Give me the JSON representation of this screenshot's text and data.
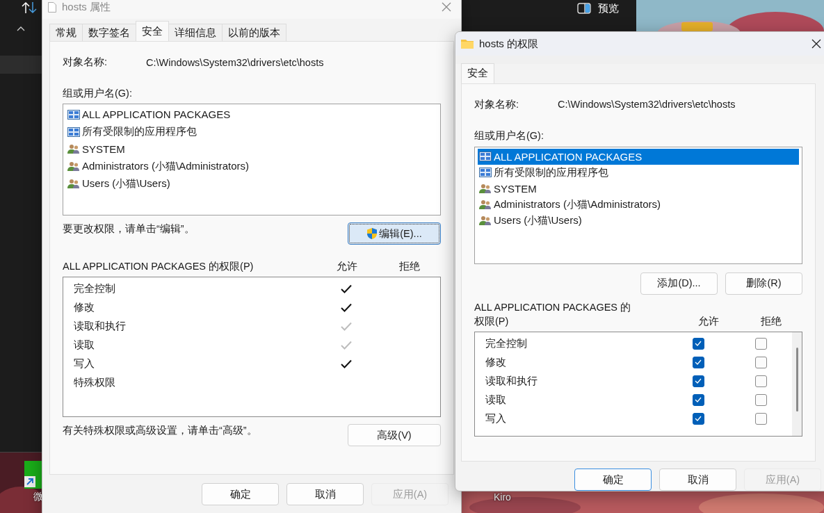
{
  "explorer": {
    "preview_label": "预览"
  },
  "desktop_icons": [
    {
      "label": "微"
    },
    {
      "label": "Kiro"
    }
  ],
  "properties_dialog": {
    "title": "hosts 属性",
    "tabs": [
      {
        "label": "常规",
        "selected": false
      },
      {
        "label": "数字签名",
        "selected": false
      },
      {
        "label": "安全",
        "selected": true
      },
      {
        "label": "详细信息",
        "selected": false
      },
      {
        "label": "以前的版本",
        "selected": false
      }
    ],
    "object_name_label": "对象名称:",
    "object_name": "C:\\Windows\\System32\\drivers\\etc\\hosts",
    "groups_label": "组或用户名(G):",
    "groups": [
      {
        "name": "ALL APPLICATION PACKAGES",
        "kind": "package",
        "selected": false
      },
      {
        "name": "所有受限制的应用程序包",
        "kind": "package",
        "selected": false
      },
      {
        "name": "SYSTEM",
        "kind": "group",
        "selected": false
      },
      {
        "name": "Administrators (小猫\\Administrators)",
        "kind": "group",
        "selected": false
      },
      {
        "name": "Users (小猫\\Users)",
        "kind": "group",
        "selected": false
      }
    ],
    "edit_hint": "要更改权限，请单击“编辑”。",
    "edit_button": {
      "label": "编辑(E)...",
      "highlighted": true
    },
    "permissions_label": "ALL APPLICATION PACKAGES 的权限(P)",
    "allow_header": "允许",
    "deny_header": "拒绝",
    "permissions": [
      {
        "name": "完全控制",
        "allow": true,
        "inherited": false,
        "deny": false
      },
      {
        "name": "修改",
        "allow": true,
        "inherited": false,
        "deny": false
      },
      {
        "name": "读取和执行",
        "allow": true,
        "inherited": true,
        "deny": false
      },
      {
        "name": "读取",
        "allow": true,
        "inherited": true,
        "deny": false
      },
      {
        "name": "写入",
        "allow": true,
        "inherited": false,
        "deny": false
      },
      {
        "name": "特殊权限",
        "allow": false,
        "deny": false
      }
    ],
    "advanced_hint": "有关特殊权限或高级设置，请单击“高级”。",
    "advanced_button": "高级(V)",
    "buttons": [
      {
        "label": "确定",
        "default": false,
        "disabled": false
      },
      {
        "label": "取消",
        "default": false,
        "disabled": false
      },
      {
        "label": "应用(A)",
        "default": false,
        "disabled": true
      }
    ]
  },
  "permissions_dialog": {
    "title": "hosts 的权限",
    "tabs": [
      {
        "label": "安全",
        "selected": true
      }
    ],
    "object_name_label": "对象名称:",
    "object_name": "C:\\Windows\\System32\\drivers\\etc\\hosts",
    "groups_label": "组或用户名(G):",
    "groups": [
      {
        "name": "ALL APPLICATION PACKAGES",
        "kind": "package",
        "selected": true
      },
      {
        "name": "所有受限制的应用程序包",
        "kind": "package",
        "selected": false
      },
      {
        "name": "SYSTEM",
        "kind": "group",
        "selected": false
      },
      {
        "name": "Administrators (小猫\\Administrators)",
        "kind": "group",
        "selected": false
      },
      {
        "name": "Users (小猫\\Users)",
        "kind": "group",
        "selected": false
      }
    ],
    "add_button": "添加(D)...",
    "remove_button": "删除(R)",
    "permissions_label": "ALL APPLICATION PACKAGES 的权限(P)",
    "allow_header": "允许",
    "deny_header": "拒绝",
    "permissions": [
      {
        "name": "完全控制",
        "allow": true,
        "deny": false
      },
      {
        "name": "修改",
        "allow": true,
        "deny": false
      },
      {
        "name": "读取和执行",
        "allow": true,
        "deny": false
      },
      {
        "name": "读取",
        "allow": true,
        "deny": false
      },
      {
        "name": "写入",
        "allow": true,
        "deny": false
      }
    ],
    "buttons": [
      {
        "label": "确定",
        "default": true,
        "disabled": false
      },
      {
        "label": "取消",
        "default": false,
        "disabled": false
      },
      {
        "label": "应用(A)",
        "default": false,
        "disabled": true
      }
    ]
  }
}
